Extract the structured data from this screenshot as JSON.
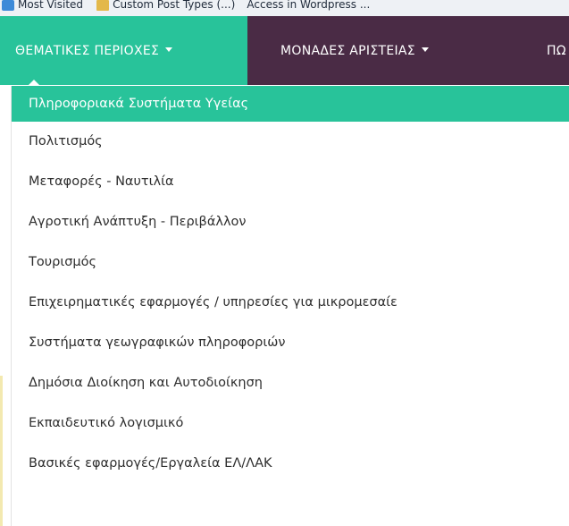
{
  "bookmarks": [
    {
      "icon": "star-icon",
      "label": "Most Visited"
    },
    {
      "icon": "folder-icon",
      "label": "Custom Post Types (...)"
    },
    {
      "icon": "",
      "label": "Access in Wordpress ..."
    }
  ],
  "navbar": {
    "items": [
      {
        "label": "ΘΕΜΑΤΙΚΕΣ ΠΕΡΙΟΧΕΣ"
      },
      {
        "label": "ΜΟΝΑΔΕΣ ΑΡΙΣΤΕΙΑΣ"
      },
      {
        "label": "ΠΩ"
      }
    ]
  },
  "dropdown": {
    "items": [
      {
        "label": "Πληροφοριακά Συστήματα Υγείας"
      },
      {
        "label": "Πολιτισμός"
      },
      {
        "label": "Μεταφορές - Ναυτιλία"
      },
      {
        "label": "Αγροτική Ανάπτυξη - Περιβάλλον"
      },
      {
        "label": "Τουρισμός"
      },
      {
        "label": "Επιχειρηματικές εφαρμογές / υπηρεσίες για μικρομεσαίε"
      },
      {
        "label": "Συστήματα γεωγραφικών πληροφοριών"
      },
      {
        "label": "Δημόσια Διοίκηση και Αυτοδιοίκηση"
      },
      {
        "label": "Εκπαιδευτικό λογισμικό"
      },
      {
        "label": "Βασικές εφαρμογές/Εργαλεία ΕΛ/ΛΑΚ"
      }
    ]
  },
  "colors": {
    "accent": "#28c39a",
    "navbar": "#4a2b45"
  }
}
